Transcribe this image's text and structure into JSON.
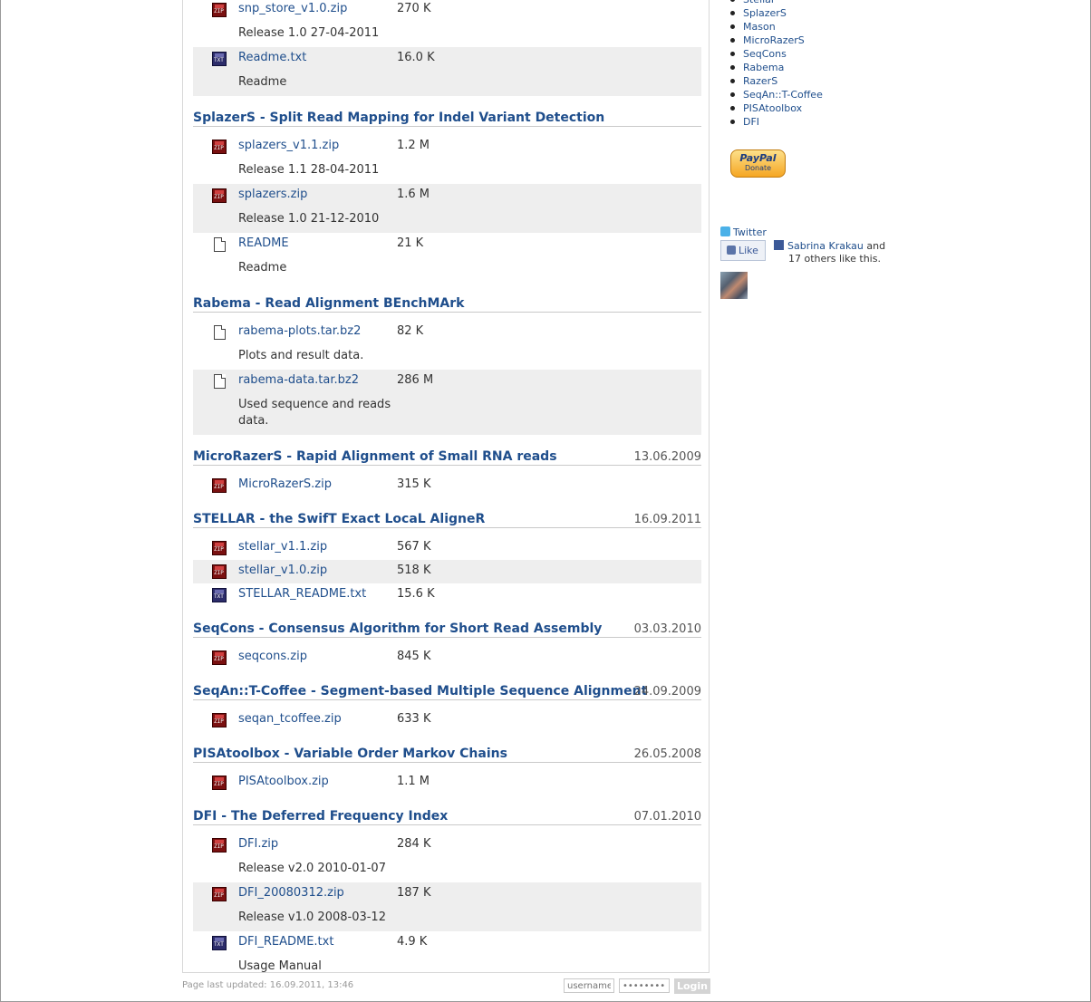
{
  "sections": [
    {
      "title": "",
      "date": "",
      "files": [
        {
          "icon": "zip",
          "name": "snp_store_v1.0.zip",
          "size": "270 K",
          "desc": "Release 1.0 27-04-2011"
        },
        {
          "icon": "txt",
          "name": "Readme.txt",
          "size": "16.0 K",
          "desc": "Readme"
        }
      ]
    },
    {
      "title": "SplazerS - Split Read Mapping for Indel Variant Detection",
      "date": "",
      "files": [
        {
          "icon": "zip",
          "name": "splazers_v1.1.zip",
          "size": "1.2 M",
          "desc": "Release 1.1 28-04-2011"
        },
        {
          "icon": "zip",
          "name": "splazers.zip",
          "size": "1.6 M",
          "desc": "Release 1.0 21-12-2010"
        },
        {
          "icon": "doc",
          "name": "README",
          "size": "21 K",
          "desc": "Readme"
        }
      ]
    },
    {
      "title": "Rabema - Read Alignment BEnchMArk",
      "date": "",
      "files": [
        {
          "icon": "doc",
          "name": "rabema-plots.tar.bz2",
          "size": "82 K",
          "desc": "Plots and result data."
        },
        {
          "icon": "doc",
          "name": "rabema-data.tar.bz2",
          "size": "286 M",
          "desc": "Used sequence and reads data."
        }
      ]
    },
    {
      "title": "MicroRazerS - Rapid Alignment of Small RNA reads",
      "date": "13.06.2009",
      "files": [
        {
          "icon": "zip",
          "name": "MicroRazerS.zip",
          "size": "315 K",
          "desc": ""
        }
      ]
    },
    {
      "title": "STELLAR - the SwifT Exact LocaL AligneR",
      "date": "16.09.2011",
      "files": [
        {
          "icon": "zip",
          "name": "stellar_v1.1.zip",
          "size": "567 K",
          "desc": ""
        },
        {
          "icon": "zip",
          "name": "stellar_v1.0.zip",
          "size": "518 K",
          "desc": ""
        },
        {
          "icon": "txt",
          "name": "STELLAR_README.txt",
          "size": "15.6 K",
          "desc": ""
        }
      ]
    },
    {
      "title": "SeqCons - Consensus Algorithm for Short Read Assembly",
      "date": "03.03.2010",
      "files": [
        {
          "icon": "zip",
          "name": "seqcons.zip",
          "size": "845 K",
          "desc": ""
        }
      ]
    },
    {
      "title": "SeqAn::T-Coffee - Segment-based Multiple Sequence Alignment",
      "date": "24.09.2009",
      "files": [
        {
          "icon": "zip",
          "name": "seqan_tcoffee.zip",
          "size": "633 K",
          "desc": ""
        }
      ]
    },
    {
      "title": "PISAtoolbox - Variable Order Markov Chains",
      "date": "26.05.2008",
      "files": [
        {
          "icon": "zip",
          "name": "PISAtoolbox.zip",
          "size": "1.1 M",
          "desc": ""
        }
      ]
    },
    {
      "title": "DFI - The Deferred Frequency Index",
      "date": "07.01.2010",
      "files": [
        {
          "icon": "zip",
          "name": "DFI.zip",
          "size": "284 K",
          "desc": "Release v2.0 2010-01-07"
        },
        {
          "icon": "zip",
          "name": "DFI_20080312.zip",
          "size": "187 K",
          "desc": "Release v1.0 2008-03-12"
        },
        {
          "icon": "txt",
          "name": "DFI_README.txt",
          "size": "4.9 K",
          "desc": "Usage Manual"
        }
      ]
    }
  ],
  "icon_text": {
    "zip": "ZIP",
    "txt": "TXT"
  },
  "footer": {
    "updated": "Page last updated: 16.09.2011, 13:46",
    "username_placeholder": "username",
    "password_placeholder": "••••••••",
    "login_label": "Login"
  },
  "sidebar": {
    "links": [
      "Stellar",
      "SplazerS",
      "Mason",
      "MicroRazerS",
      "SeqCons",
      "Rabema",
      "RazerS",
      "SeqAn::T-Coffee",
      "PISAtoolbox",
      "DFI"
    ],
    "paypal": {
      "brand": "PayPal",
      "action": "Donate"
    },
    "twitter_label": "Twitter",
    "like_label": "Like",
    "fb_name": "Sabrina Krakau",
    "fb_suffix": " and",
    "fb_line2": "17 others like this."
  },
  "colors": {
    "link": "#1f4e8c",
    "alt_row": "#eeeeee"
  }
}
